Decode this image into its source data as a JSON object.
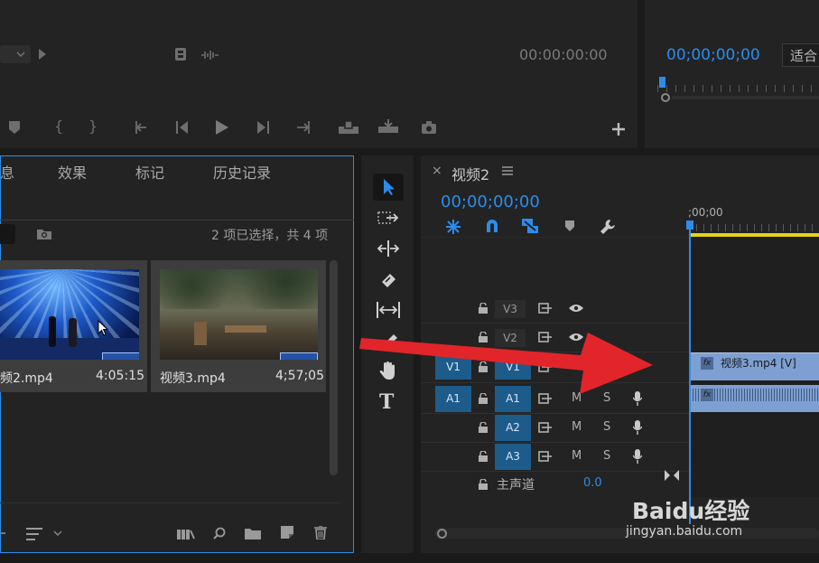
{
  "source_monitor": {
    "timecode": "00:00:00:00"
  },
  "program_monitor": {
    "timecode": "00;00;00;00",
    "fit_label": "适合"
  },
  "project_panel": {
    "tabs": [
      {
        "label": "息"
      },
      {
        "label": "效果"
      },
      {
        "label": "标记"
      },
      {
        "label": "历史记录"
      }
    ],
    "selection_status": "2 项已选择，共 4 项",
    "clips": [
      {
        "name": "频2.mp4",
        "duration": "4:05:15"
      },
      {
        "name": "视频3.mp4",
        "duration": "4;57;05"
      }
    ]
  },
  "timeline": {
    "sequence_tab": "视频2",
    "timecode": "00;00;00;00",
    "ruler_start": ";00;00",
    "tracks": [
      {
        "label": "V3",
        "source": ""
      },
      {
        "label": "V2",
        "source": ""
      },
      {
        "label": "V1",
        "source": "V1"
      },
      {
        "label": "A1",
        "source": "A1",
        "mute": "M",
        "solo": "S"
      },
      {
        "label": "A2",
        "source": "",
        "mute": "M",
        "solo": "S"
      },
      {
        "label": "A3",
        "source": "",
        "mute": "M",
        "solo": "S"
      }
    ],
    "master": {
      "label": "主声道",
      "value": "0.0"
    },
    "video_clip": {
      "name": "视频3.mp4 [V]",
      "fx": "fx"
    },
    "audio_clip": {
      "fx": "fx"
    }
  },
  "watermark": {
    "brand": "Baidu经验",
    "url": "jingyan.baidu.com"
  },
  "colors": {
    "accent_blue": "#2d8ceb",
    "clip_blue": "#7d9fd2",
    "arrow_red": "#e1252a",
    "work_area_yellow": "#e6d21a",
    "panel_bg": "#232323"
  }
}
